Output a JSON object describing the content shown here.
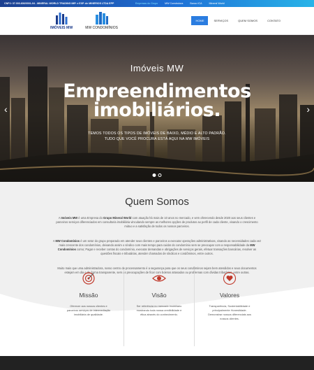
{
  "topbar": {
    "company": "CNPJ: 37.003.836/0001-04 - MINERAL WORLD TRADING IMP. e EXP. de MINERIOS LTDA EPP",
    "links": [
      "Empresas do Grupo",
      "MW Construtora",
      "Banco ICA",
      "Mineral World"
    ]
  },
  "logos": [
    {
      "label": "IMÓVEIS MW",
      "icon": "building-logo-icon"
    },
    {
      "label": "MW CONDOMÍNIOS",
      "icon": "buildings-logo-icon"
    }
  ],
  "nav": [
    "HOME",
    "SERVIÇOS",
    "QUEM SOMOS",
    "CONTATO"
  ],
  "hero": {
    "kicker": "Imóveis MW",
    "title_line1": "Empreendimentos",
    "title_line2": "imobiliários.",
    "sub_line1": "TEMOS TODOS OS TIPOS DE IMÓVEIS DE BAIXO, MÉDIO E ALTO PADRÃO.",
    "sub_line2": "TUDO QUE VOCÊ PROCURA ESTÁ AQUI NA MW IMÓVEIS",
    "arrow_left": "‹",
    "arrow_right": "›"
  },
  "about": {
    "title": "Quem Somos",
    "p1_a": "A ",
    "p1_b": "Imóveis MW",
    "p1_c": " é uma Empresa do ",
    "p1_d": "Grupo Mineral World",
    "p1_e": " com atuação há mais de 10 anos no mercado, e vem oferecendo desde 2020 aos seus clientes e parceiros serviços diferenciados em consultoria imobiliária vinculando sempre as melhores opções de produtos ao perfil de cada cliente, visando o crescimento mútuo e a satisfação de todos os nossos parceiros.",
    "p2_a": "A ",
    "p2_b": "MW Condomínios",
    "p2_c": " é um setor do grupo preparado em atender seus clientes e parceiros a executar operações administrativas, visando as necessidades cada vez mais crescente dos condomínios, deixando assim o síndico com mais tempo para cuidar do condomínio sem se preocupar com a responsabilidade da ",
    "p2_d": "MW Condomínios",
    "p2_e": " como; Pagar e receber contas do condomínio, executar demandas e obrigações de serviços gerais, efetuar transações bancárias, resolver as questões fiscais e tributárias, atender chamados de síndicos e condôminos, entre outros.",
    "p3": "Muito mais que uma administradora, nosso centro de processamento é a segurança para que os seus condôminos sejam bem atendidos e seus documentos estejam em dia e de forma transparente, sem as preocupações de ficar com boletos atrasados ou problemas com dívidas tributárias, entre outras."
  },
  "cards": [
    {
      "icon": "target-icon",
      "title": "Missão",
      "text": "Oferecer aos nossos clientes e parceiros serviços de intermediação imobiliária de qualidade."
    },
    {
      "icon": "eye-icon",
      "title": "Visão",
      "text": "Ser referência no mercado imobiliário mostrando toda nossa credibilidade e ética através do conhecimento."
    },
    {
      "icon": "heart-hands-icon",
      "title": "Valores",
      "text": "Transparência, Sustentabilidade e principalmente Honestidade. Demonstrar nossos diferenciais aos nossos clientes."
    }
  ],
  "colors": {
    "accent": "#2b7de0",
    "brand": "#1a3a8a",
    "footer": "#222222"
  }
}
